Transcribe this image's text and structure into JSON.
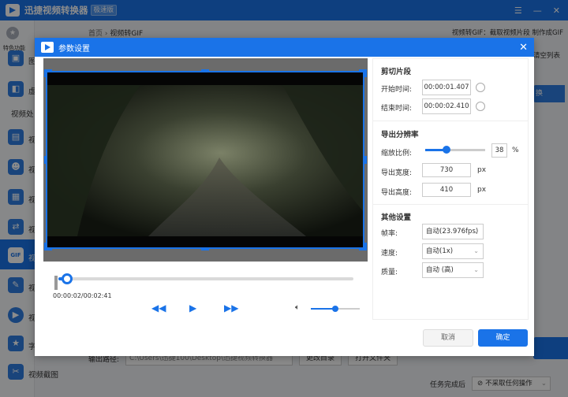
{
  "app": {
    "title": "迅捷视频转换器",
    "badge": "极速版"
  },
  "sidebar": {
    "feature_label": "特色功能",
    "heading": "视频处",
    "items": [
      {
        "label": "图",
        "icon": "image-icon"
      },
      {
        "label": "虚",
        "icon": "virtual-icon"
      },
      {
        "label": "视",
        "icon": "video-icon"
      },
      {
        "label": "视",
        "icon": "person-icon"
      },
      {
        "label": "视",
        "icon": "video-merge-icon"
      },
      {
        "label": "视",
        "icon": "video-convert-icon"
      },
      {
        "label": "视",
        "icon": "gif-icon",
        "badge": "GIF"
      },
      {
        "label": "视",
        "icon": "video-edit-icon"
      },
      {
        "label": "视",
        "icon": "play-icon"
      },
      {
        "label": "字",
        "icon": "star-icon"
      },
      {
        "label": "视频截图",
        "icon": "screenshot-icon"
      }
    ]
  },
  "breadcrumb": {
    "home": "首页",
    "current": "视频转GIF"
  },
  "top_tip": "视频转GIF：截取视频片段 制作成GIF",
  "clear_list": "清空列表",
  "bg_button": "换",
  "output": {
    "label": "输出路径:",
    "path": "C:\\Users\\迅捷100\\Desktop\\迅捷视频转换器",
    "change_dir": "更改目录",
    "open_folder": "打开文件夹"
  },
  "bottom": {
    "label": "任务完成后",
    "select_value": "不采取任何操作"
  },
  "modal": {
    "title": "参数设置",
    "clip": {
      "section": "剪切片段",
      "start_label": "开始时间:",
      "start_value": "00:00:01.407",
      "end_label": "结束时间:",
      "end_value": "00:00:02.410"
    },
    "resolution": {
      "section": "导出分辨率",
      "scale_label": "缩放比例:",
      "scale_value": "38",
      "scale_unit": "%",
      "scale_fraction": 0.38,
      "width_label": "导出宽度:",
      "width_value": "730",
      "height_label": "导出高度:",
      "height_value": "410",
      "unit": "px"
    },
    "other": {
      "section": "其他设置",
      "fps_label": "帧率:",
      "fps_value": "自动(23.976fps)",
      "speed_label": "速度:",
      "speed_value": "自动(1x)",
      "quality_label": "质量:",
      "quality_value": "自动 (高)"
    },
    "player": {
      "time": "00:00:02/00:02:41",
      "progress_fraction": 0.012,
      "volume_fraction": 0.5
    },
    "cancel": "取消",
    "ok": "确定"
  }
}
